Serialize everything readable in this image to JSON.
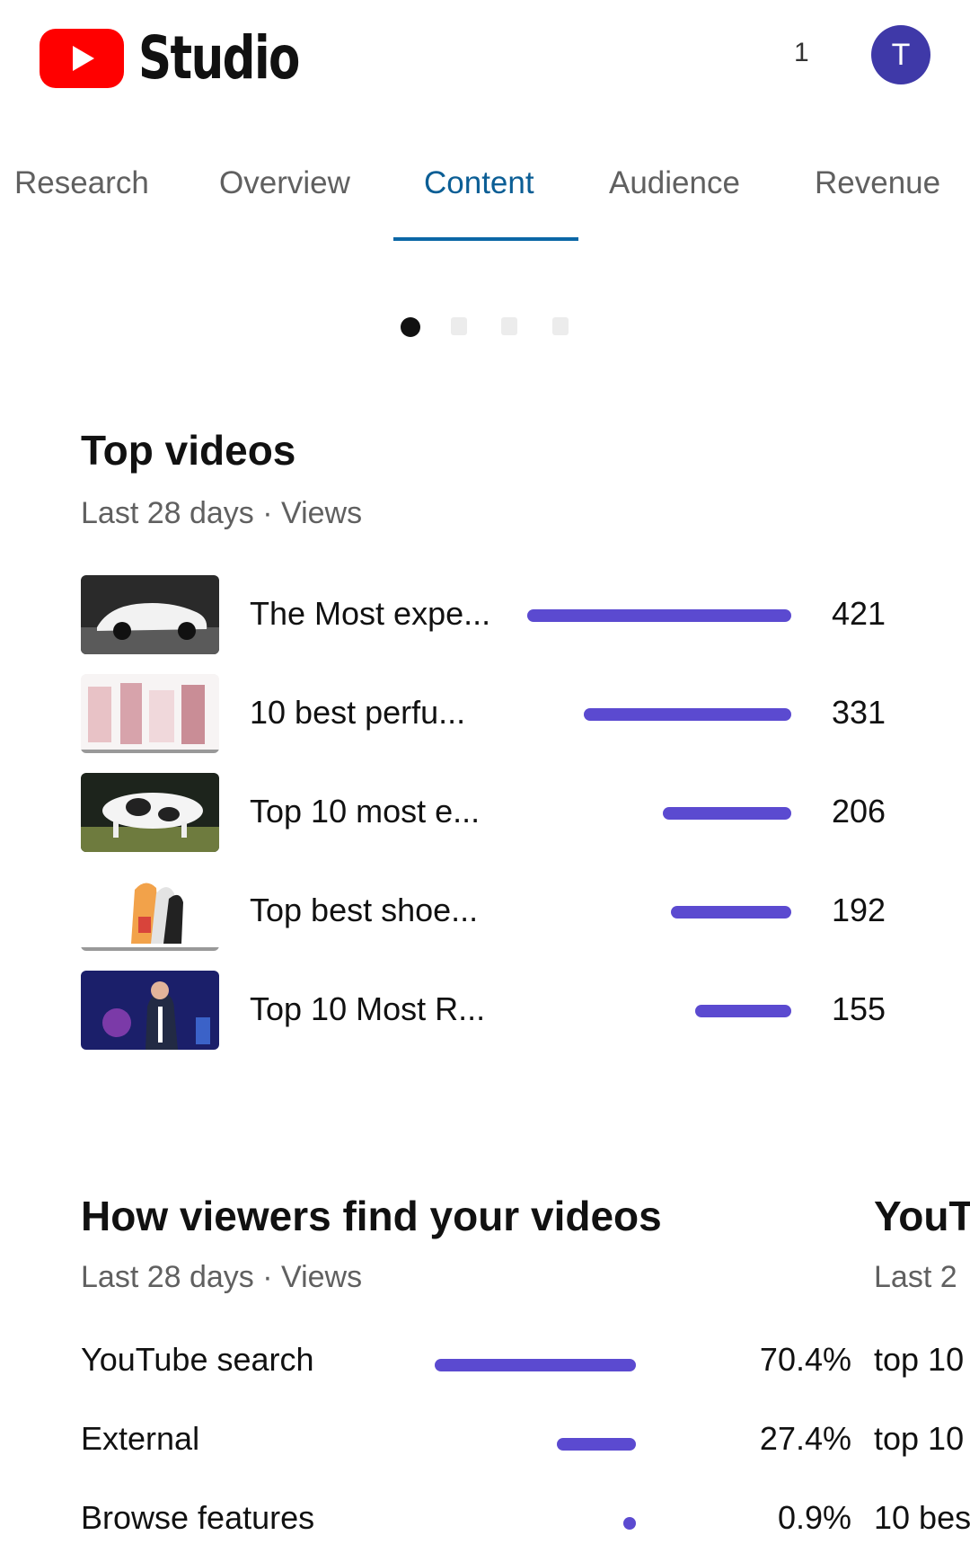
{
  "header": {
    "app_name": "Studio",
    "notification_count": "1",
    "avatar_initial": "T"
  },
  "tabs": [
    {
      "label": "Research",
      "active": false
    },
    {
      "label": "Overview",
      "active": false
    },
    {
      "label": "Content",
      "active": true
    },
    {
      "label": "Audience",
      "active": false
    },
    {
      "label": "Revenue",
      "active": false
    }
  ],
  "carousel": {
    "page_count": 4,
    "active_index": 0
  },
  "top_videos": {
    "title": "Top videos",
    "subtitle": "Last 28 days · Views",
    "bar_color": "#5b4ad0",
    "items": [
      {
        "title": "The Most expe...",
        "views": "421",
        "value": 421
      },
      {
        "title": "10 best perfu...",
        "views": "331",
        "value": 331
      },
      {
        "title": "Top 10 most e...",
        "views": "206",
        "value": 206
      },
      {
        "title": "Top best shoe...",
        "views": "192",
        "value": 192
      },
      {
        "title": "Top 10 Most R...",
        "views": "155",
        "value": 155
      }
    ]
  },
  "traffic_sources": {
    "title": "How viewers find your videos",
    "subtitle": "Last 28 days · Views",
    "items": [
      {
        "label": "YouTube search",
        "percent": "70.4%",
        "value": 70.4
      },
      {
        "label": "External",
        "percent": "27.4%",
        "value": 27.4
      },
      {
        "label": "Browse features",
        "percent": "0.9%",
        "value": 0.9
      }
    ]
  },
  "next_card": {
    "title": "YouT",
    "subtitle": "Last 2",
    "items": [
      "top 10",
      "top 10",
      "10 bes"
    ]
  }
}
